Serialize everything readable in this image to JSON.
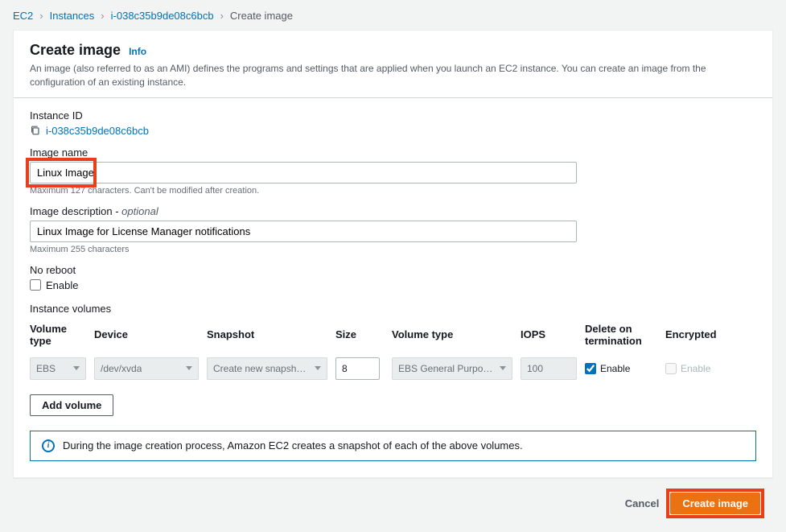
{
  "breadcrumb": {
    "items": [
      "EC2",
      "Instances",
      "i-038c35b9de08c6bcb"
    ],
    "current": "Create image"
  },
  "header": {
    "title": "Create image",
    "info": "Info",
    "description": "An image (also referred to as an AMI) defines the programs and settings that are applied when you launch an EC2 instance. You can create an image from the configuration of an existing instance."
  },
  "instance_id": {
    "label": "Instance ID",
    "value": "i-038c35b9de08c6bcb"
  },
  "image_name": {
    "label": "Image name",
    "value": "Linux Image",
    "helper": "Maximum 127 characters. Can't be modified after creation."
  },
  "image_desc": {
    "label": "Image description - ",
    "optional": "optional",
    "value": "Linux Image for License Manager notifications",
    "helper": "Maximum 255 characters"
  },
  "no_reboot": {
    "label": "No reboot",
    "enable": "Enable",
    "checked": false
  },
  "volumes": {
    "label": "Instance volumes",
    "headers": {
      "vtype1": "Volume type",
      "device": "Device",
      "snapshot": "Snapshot",
      "size": "Size",
      "vtype2": "Volume type",
      "iops": "IOPS",
      "del_term": "Delete on termination",
      "encrypted": "Encrypted"
    },
    "row": {
      "vtype1": "EBS",
      "device": "/dev/xvda",
      "snapshot": "Create new snapshot fr...",
      "size": "8",
      "vtype2": "EBS General Purpose S...",
      "iops": "100",
      "del_enable": "Enable",
      "del_checked": true,
      "enc_enable": "Enable",
      "enc_checked": false
    },
    "add_button": "Add volume"
  },
  "banner": {
    "text": "During the image creation process, Amazon EC2 creates a snapshot of each of the above volumes."
  },
  "footer": {
    "cancel": "Cancel",
    "create": "Create image"
  }
}
